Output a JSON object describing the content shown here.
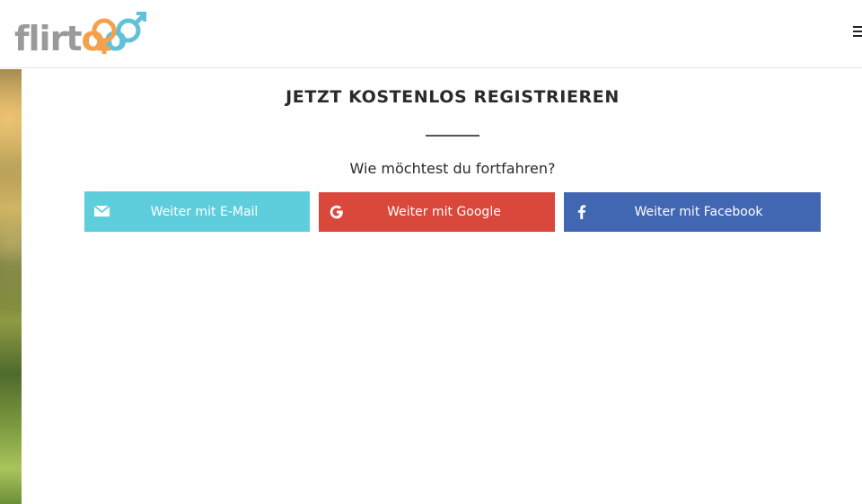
{
  "header": {
    "logo_text": "flirtoo",
    "logo_alt": "flirtoo logo"
  },
  "main": {
    "title": "JETZT KOSTENLOS REGISTRIEREN",
    "subtitle": "Wie möchtest du fortfahren?",
    "buttons": [
      {
        "label": "Weiter mit E-Mail",
        "icon": "envelope-icon",
        "color": "#5fcedc"
      },
      {
        "label": "Weiter mit Google",
        "icon": "google-icon",
        "color": "#d9483b"
      },
      {
        "label": "Weiter mit Facebook",
        "icon": "facebook-icon",
        "color": "#4267b2"
      }
    ]
  },
  "colors": {
    "logo_gray": "#9a9a9a",
    "logo_orange": "#f5a04a",
    "logo_blue": "#5fc2d8"
  }
}
